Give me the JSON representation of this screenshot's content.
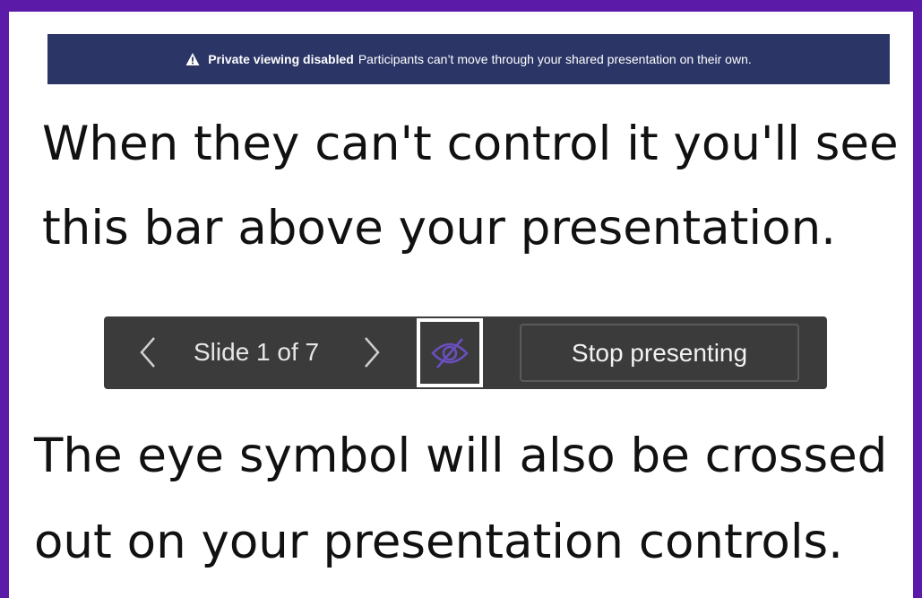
{
  "banner": {
    "icon": "warning-triangle-icon",
    "title": "Private viewing disabled",
    "message": "Participants can’t move through your shared presentation on their own."
  },
  "caption_top": {
    "line1": "When they can't control it you'll see",
    "line2": "this bar above your presentation."
  },
  "presenter_controls": {
    "prev_icon": "chevron-left-icon",
    "slide_counter": "Slide 1 of 7",
    "next_icon": "chevron-right-icon",
    "private_view_icon": "eye-crossed-out-icon",
    "stop_label": "Stop presenting"
  },
  "caption_bottom": {
    "line1": "The eye symbol will also be crossed",
    "line2": "out on your presentation controls."
  },
  "colors": {
    "frame": "#5b1aa8",
    "banner_bg": "#2b3566",
    "controls_bg": "#3b3b3b",
    "eye_icon": "#6b4fc0"
  }
}
